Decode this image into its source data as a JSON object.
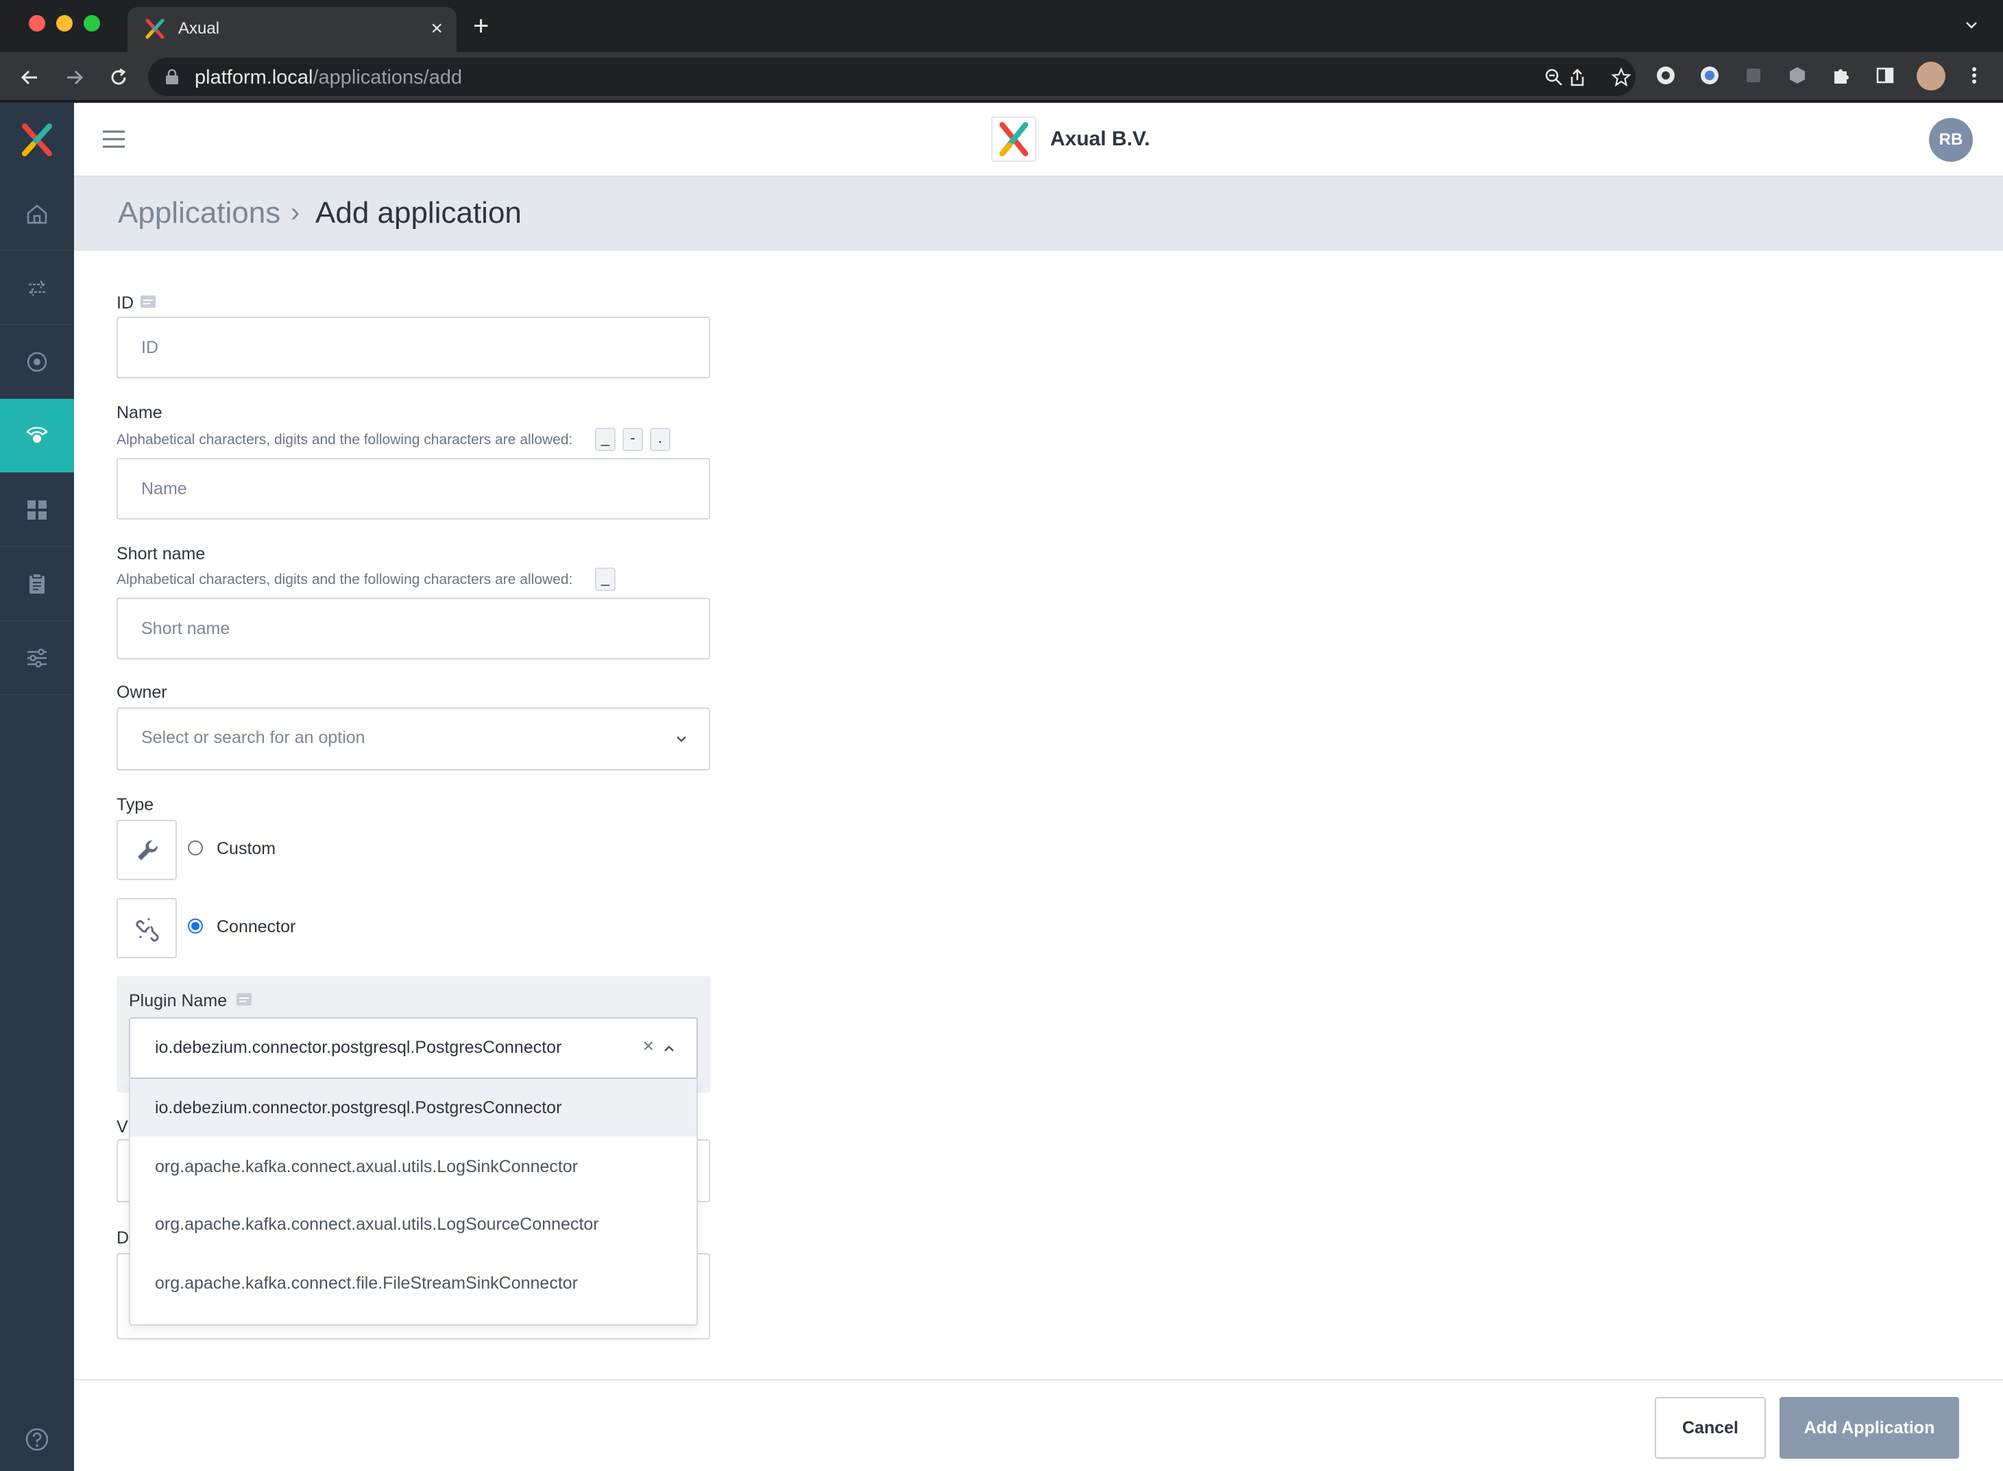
{
  "browser": {
    "tab_title": "Axual",
    "new_tab": "+",
    "tab_close": "×",
    "url_host": "platform.local",
    "url_path": "/applications/add"
  },
  "header": {
    "company": "Axual B.V.",
    "user_initials": "RB"
  },
  "sidebar": {
    "items": [
      {
        "icon": "home-icon",
        "active": false
      },
      {
        "icon": "streams-icon",
        "active": false
      },
      {
        "icon": "environments-icon",
        "active": false
      },
      {
        "icon": "applications-icon",
        "active": true
      },
      {
        "icon": "dashboard-icon",
        "active": false
      },
      {
        "icon": "clipboard-icon",
        "active": false
      },
      {
        "icon": "settings-sliders-icon",
        "active": false
      }
    ],
    "help_icon": "help-icon"
  },
  "breadcrumb": {
    "parent": "Applications",
    "separator": "›",
    "current": "Add application"
  },
  "form": {
    "id": {
      "label": "ID",
      "placeholder": "ID"
    },
    "name": {
      "label": "Name",
      "hint": "Alphabetical characters, digits and the following characters are allowed:",
      "chars": [
        "_",
        "-",
        "."
      ],
      "placeholder": "Name"
    },
    "short_name": {
      "label": "Short name",
      "hint": "Alphabetical characters, digits and the following characters are allowed:",
      "chars": [
        "_"
      ],
      "placeholder": "Short name"
    },
    "owner": {
      "label": "Owner",
      "placeholder": "Select or search for an option"
    },
    "type": {
      "label": "Type",
      "options": [
        {
          "label": "Custom",
          "checked": false
        },
        {
          "label": "Connector",
          "checked": true
        }
      ]
    },
    "plugin": {
      "label": "Plugin Name",
      "value": "io.debezium.connector.postgresql.PostgresConnector",
      "clear": "×",
      "options": [
        "io.debezium.connector.postgresql.PostgresConnector",
        "org.apache.kafka.connect.axual.utils.LogSinkConnector",
        "org.apache.kafka.connect.axual.utils.LogSourceConnector",
        "org.apache.kafka.connect.file.FileStreamSinkConnector"
      ]
    },
    "hidden_label_v": "V",
    "hidden_label_d": "D"
  },
  "footer": {
    "cancel": "Cancel",
    "submit": "Add Application"
  },
  "colors": {
    "sidebar": "#2b3848",
    "active": "#22b5b0",
    "primary_disabled": "#8a99ae"
  }
}
